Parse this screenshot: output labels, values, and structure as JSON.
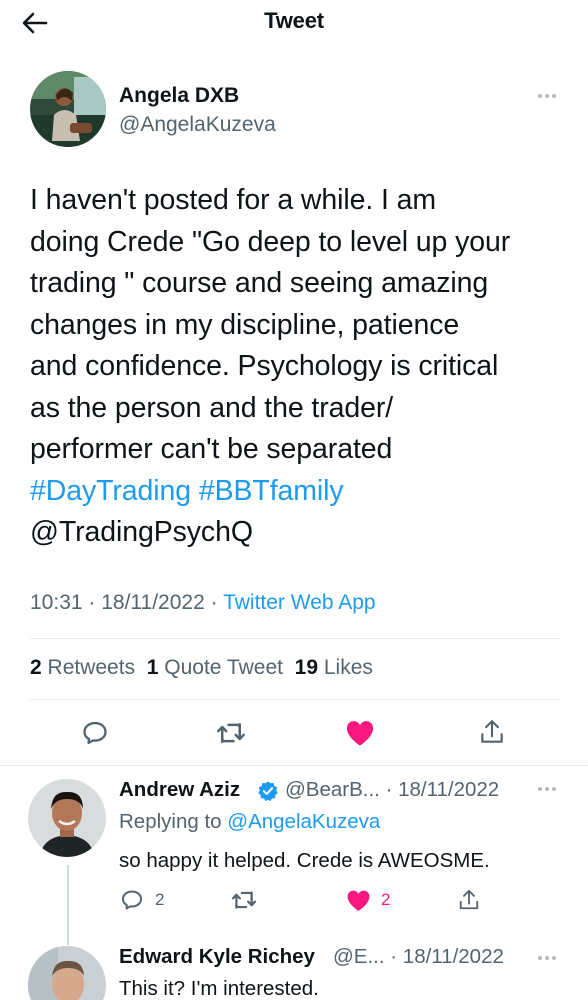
{
  "header": {
    "title": "Tweet"
  },
  "tweet": {
    "author_name": "Angela DXB",
    "author_handle": "@AngelaKuzeva",
    "text_lines": [
      "I haven't posted for a while. I am",
      "doing Crede \"Go deep to level up your",
      "trading \" course and seeing amazing",
      "changes in my discipline, patience",
      "and confidence. Psychology is critical",
      "as the person and the trader/",
      "performer can't be separated"
    ],
    "hashtag_1": "#DayTrading",
    "hashtag_2": "#BBTfamily",
    "mention": "@TradingPsychQ",
    "time": "10:31",
    "date": "18/11/2022",
    "source": "Twitter Web App",
    "retweets_count": "2",
    "retweets_label": "Retweets",
    "quotes_count": "1",
    "quotes_label": "Quote Tweet",
    "likes_count": "19",
    "likes_label": "Likes"
  },
  "replies": [
    {
      "name": "Andrew Aziz",
      "handle_date": "@BearB... · 18/11/2022",
      "replying_prefix": "Replying to",
      "replying_to": "@AngelaKuzeva",
      "text": "so happy it helped. Crede is AWEOSME.",
      "reply_count": "2",
      "like_count": "2"
    },
    {
      "name": "Edward Kyle Richey",
      "handle_date": "@E... · 18/11/2022",
      "text": "This it? I'm interested."
    }
  ],
  "colors": {
    "accent": "#1d9bf0",
    "like": "#f91880",
    "muted": "#536471",
    "verified": "#1d9bf0"
  },
  "icons": [
    "back-arrow-icon",
    "more-icon",
    "reply-icon",
    "retweet-icon",
    "heart-icon",
    "share-icon",
    "verified-badge-icon"
  ]
}
